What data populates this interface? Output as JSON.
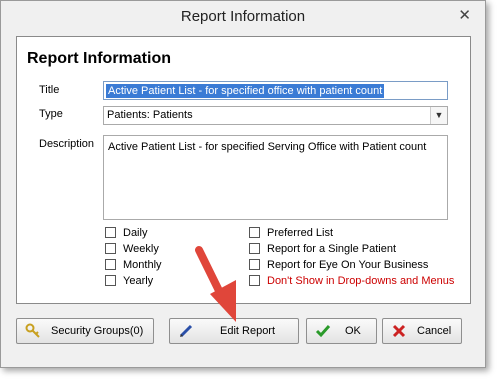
{
  "window": {
    "title": "Report Information",
    "close_glyph": "✕"
  },
  "form": {
    "heading": "Report Information",
    "title_label": "Title",
    "title_value": "Active Patient List - for specified office with patient count",
    "type_label": "Type",
    "type_value": "Patients: Patients",
    "description_label": "Description",
    "description_value": "Active Patient List - for specified Serving Office with Patient count"
  },
  "schedules": [
    {
      "label": "Daily",
      "checked": false
    },
    {
      "label": "Weekly",
      "checked": false
    },
    {
      "label": "Monthly",
      "checked": false
    },
    {
      "label": "Yearly",
      "checked": false
    }
  ],
  "options": [
    {
      "label": "Preferred List",
      "checked": false
    },
    {
      "label": "Report for a Single Patient",
      "checked": false
    },
    {
      "label": "Report for Eye On Your Business",
      "checked": false
    },
    {
      "label": "Don't Show in Drop-downs and Menus",
      "checked": false,
      "color": "#cc0000"
    }
  ],
  "buttons": {
    "security_groups": "Security Groups(0)",
    "edit_report": "Edit Report",
    "ok": "OK",
    "cancel": "Cancel"
  },
  "icons": {
    "security_groups": "key-icon",
    "edit_report": "pen-icon",
    "ok": "checkmark-icon",
    "cancel": "x-icon",
    "annotation": "red-arrow-icon"
  },
  "colors": {
    "accent": "#3a7bd5",
    "annotation_arrow": "#e0463a",
    "ok_check": "#2a9a2a",
    "cancel_x": "#cc2222"
  }
}
